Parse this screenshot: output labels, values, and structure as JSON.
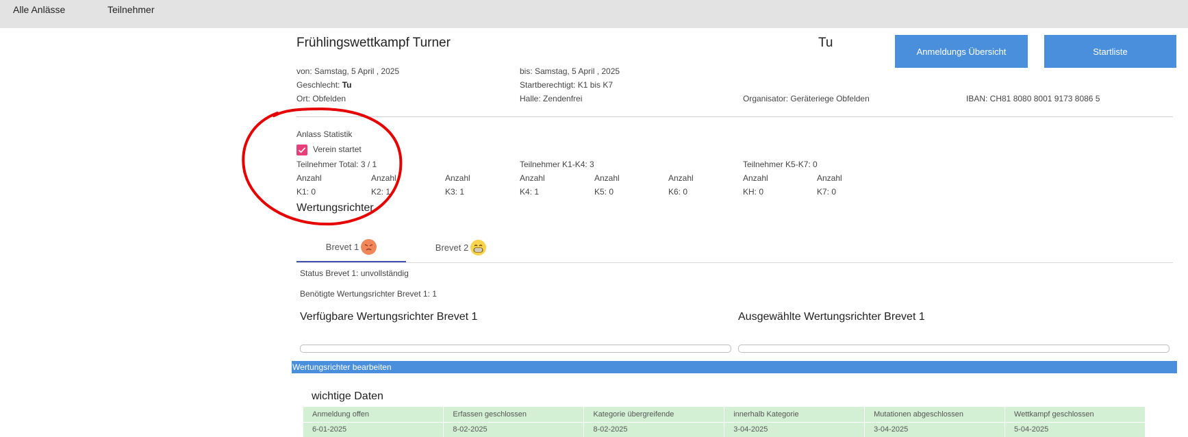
{
  "nav": {
    "items": [
      "Alle Anlässe",
      "Teilnehmer"
    ]
  },
  "event": {
    "title": "Frühlingswettkampf Turner",
    "gender_short": "Tu",
    "from": "von: Samstag, 5 April , 2025",
    "to": "bis: Samstag, 5 April , 2025",
    "gender_label": "Geschlecht: ",
    "gender_value": "Tu",
    "eligible": "Startberechtigt: K1 bis K7",
    "location": "Ort: Obfelden",
    "hall": "Halle: Zendenfrei",
    "organizer": "Organisator: Geräteriege Obfelden",
    "iban": "IBAN: CH81 8080 8001 9173 8086 5"
  },
  "buttons": {
    "overview": "Anmeldungs Übersicht",
    "startlist": "Startliste"
  },
  "stats": {
    "title": "Anlass Statistik",
    "verein_startet_label": "Verein startet",
    "verein_startet_checked": true,
    "total": "Teilnehmer Total: 3 / 1",
    "k1_k4": "Teilnehmer K1-K4: 3",
    "k5_k7": "Teilnehmer K5-K7: 0",
    "categories": [
      {
        "label": "Anzahl",
        "value": "K1: 0"
      },
      {
        "label": "Anzahl",
        "value": "K2: 1"
      },
      {
        "label": "Anzahl",
        "value": "K3: 1"
      },
      {
        "label": "Anzahl",
        "value": "K4: 1"
      },
      {
        "label": "Anzahl",
        "value": "K5: 0"
      },
      {
        "label": "Anzahl",
        "value": "K6: 0"
      },
      {
        "label": "Anzahl",
        "value": "KH: 0"
      },
      {
        "label": "Anzahl",
        "value": "K7: 0"
      }
    ]
  },
  "judges": {
    "title": "Wertungsrichter",
    "tabs": [
      {
        "label": "Brevet 1",
        "icon": "angry-face-icon"
      },
      {
        "label": "Brevet 2",
        "icon": "grinning-face-icon"
      }
    ],
    "status": "Status Brevet 1: unvollständig",
    "required": "Benötigte Wertungsrichter Brevet 1: 1",
    "available_title": "Verfügbare Wertungsrichter Brevet 1",
    "selected_title": "Ausgewählte Wertungsrichter Brevet 1",
    "edit_label": "Wertungsrichter bearbeiten"
  },
  "dates": {
    "title": "wichtige Daten",
    "headers": [
      "Anmeldung offen",
      "Erfassen geschlossen",
      "Kategorie übergreifende",
      "innerhalb Kategorie",
      "Mutationen abgeschlossen",
      "Wettkampf geschlossen"
    ],
    "values": [
      "6-01-2025",
      "8-02-2025",
      "8-02-2025",
      "3-04-2025",
      "3-04-2025",
      "5-04-2025"
    ]
  },
  "colors": {
    "topbar": "#e3e3e3",
    "button": "#4a8fdb",
    "checkbox": "#e5407a",
    "table_bg": "#d4f0d4",
    "annotation": "#e60000",
    "tab_underline": "#3f51b5"
  }
}
